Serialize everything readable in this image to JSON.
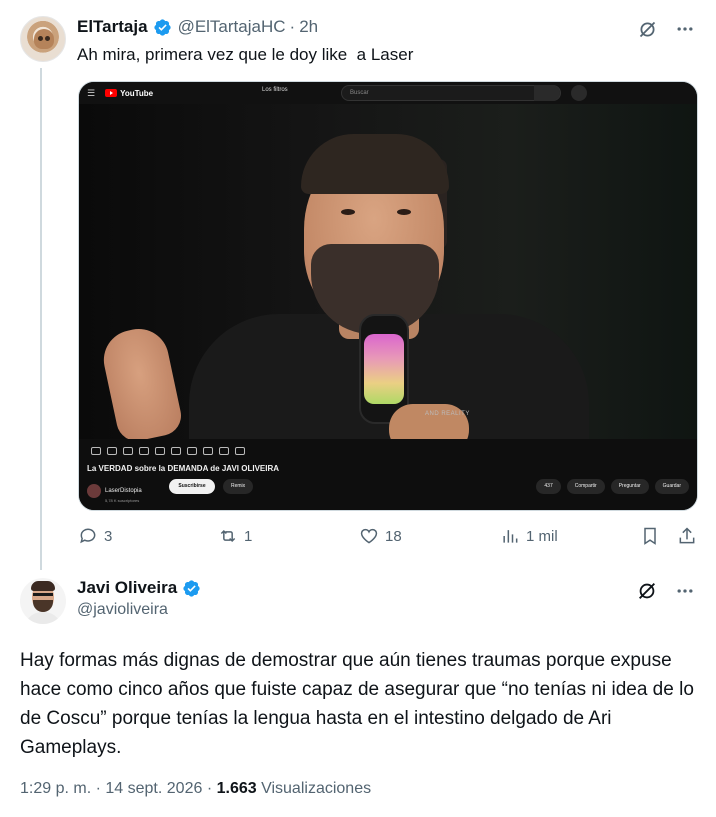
{
  "colors": {
    "accent": "#1d9bf0",
    "text_primary": "#0f1419",
    "text_secondary": "#536471",
    "thread_line": "#cfd9de"
  },
  "tweet1": {
    "name": "ElTartaja",
    "handle": "@ElTartajaHC",
    "time": "2h",
    "text": "Ah mira, primera vez que le doy like  a Laser",
    "media": {
      "yt_logo": "YouTube",
      "filter_label": "Los filtros",
      "search_placeholder": "Buscar",
      "video_title": "La VERDAD sobre la DEMANDA de JAVI OLIVEIRA",
      "channel_name": "LaserDistopia",
      "channel_subs": "5,78 K suscriptores",
      "subscribe_label": "Suscribirse",
      "remix_label": "Remix",
      "like_count": "437",
      "share_label": "Compartir",
      "ask_label": "Preguntar",
      "save_label": "Guardar",
      "shirt_text": "AND REALITY"
    },
    "actions": {
      "replies": "3",
      "reposts": "1",
      "likes": "18",
      "views": "1 mil"
    }
  },
  "tweet2": {
    "name": "Javi Oliveira",
    "handle": "@javioliveira",
    "text": "Hay formas más dignas de demostrar que aún tienes traumas porque expuse hace como cinco años que fuiste capaz de asegurar que “no tenías ni idea de lo de Coscu” porque tenías la lengua hasta en el intestino delgado de Ari Gameplays.",
    "time": "1:29 p. m.",
    "date": "14 sept. 2026",
    "views_count": "1.663",
    "views_label": "Visualizaciones"
  },
  "icons": [
    "verified-badge-icon",
    "grok-icon",
    "more-icon",
    "reply-icon",
    "repost-icon",
    "like-icon",
    "views-icon",
    "bookmark-icon",
    "share-icon"
  ]
}
